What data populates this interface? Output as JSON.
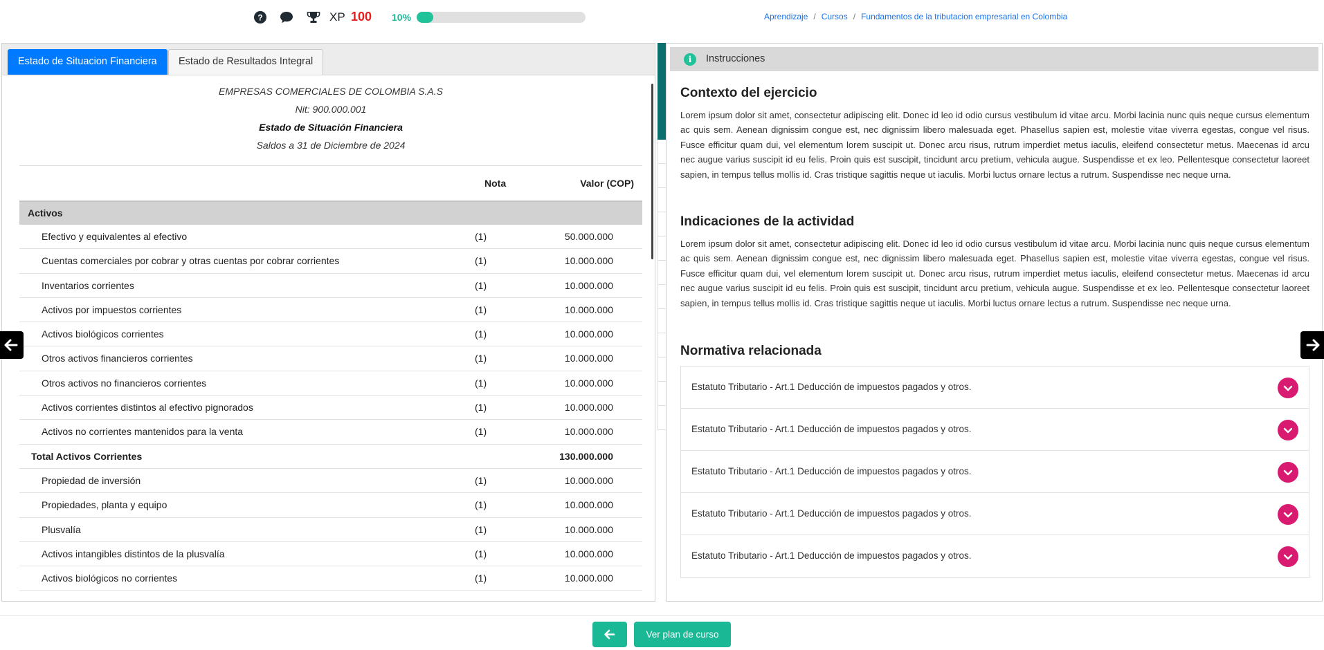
{
  "header": {
    "xp_label": "XP",
    "xp_value": "100",
    "progress_text": "10%",
    "progress_fraction": 0.1,
    "icons": [
      "help-icon",
      "chat-icon",
      "trophy-icon"
    ],
    "breadcrumb": [
      "Aprendizaje",
      "Cursos",
      "Fundamentos de la tributacion empresarial en Colombia"
    ]
  },
  "left": {
    "tabs": [
      "Estado de Situacion Financiera",
      "Estado de Resultados Integral"
    ],
    "company": "EMPRESAS COMERCIALES DE COLOMBIA S.A.S",
    "nit": "Nit: 900.000.001",
    "statement_title": "Estado de Situación Financiera",
    "balance_date": "Saldos a 31 de Diciembre de 2024",
    "columns": {
      "nota": "Nota",
      "valor": "Valor (COP)"
    },
    "section": "Activos",
    "rows_current": [
      {
        "label": "Efectivo y equivalentes al efectivo",
        "nota": "(1)",
        "valor": "50.000.000"
      },
      {
        "label": "Cuentas comerciales por cobrar y otras cuentas por cobrar corrientes",
        "nota": "(1)",
        "valor": "10.000.000"
      },
      {
        "label": "Inventarios corrientes",
        "nota": "(1)",
        "valor": "10.000.000"
      },
      {
        "label": "Activos por impuestos corrientes",
        "nota": "(1)",
        "valor": "10.000.000"
      },
      {
        "label": "Activos biológicos corrientes",
        "nota": "(1)",
        "valor": "10.000.000"
      },
      {
        "label": "Otros activos financieros corrientes",
        "nota": "(1)",
        "valor": "10.000.000"
      },
      {
        "label": "Otros activos no financieros corrientes",
        "nota": "(1)",
        "valor": "10.000.000"
      },
      {
        "label": "Activos corrientes distintos al efectivo pignorados",
        "nota": "(1)",
        "valor": "10.000.000"
      },
      {
        "label": "Activos no corrientes mantenidos para la venta",
        "nota": "(1)",
        "valor": "10.000.000"
      }
    ],
    "total_current": {
      "label": "Total Activos Corrientes",
      "valor": "130.000.000"
    },
    "rows_noncurrent": [
      {
        "label": "Propiedad de inversión",
        "nota": "(1)",
        "valor": "10.000.000"
      },
      {
        "label": "Propiedades, planta y equipo",
        "nota": "(1)",
        "valor": "10.000.000"
      },
      {
        "label": "Plusvalía",
        "nota": "(1)",
        "valor": "10.000.000"
      },
      {
        "label": "Activos intangibles distintos de la plusvalía",
        "nota": "(1)",
        "valor": "10.000.000"
      },
      {
        "label": "Activos biológicos no corrientes",
        "nota": "(1)",
        "valor": "10.000.000"
      }
    ]
  },
  "right": {
    "instructions_title": "Instrucciones",
    "context_title": "Contexto del ejercicio",
    "context_text": "Lorem ipsum dolor sit amet, consectetur adipiscing elit. Donec id leo id odio cursus vestibulum id vitae arcu. Morbi lacinia nunc quis neque cursus elementum ac quis sem. Aenean dignissim congue est, nec dignissim libero malesuada eget. Phasellus sapien est, molestie vitae viverra egestas, congue vel risus. Fusce efficitur quam dui, vel elementum lorem suscipit ut. Donec arcu risus, rutrum imperdiet metus iaculis, eleifend consectetur metus. Maecenas id arcu nec augue varius suscipit id eu felis. Proin quis est suscipit, tincidunt arcu pretium, vehicula augue. Suspendisse et ex leo. Pellentesque consectetur laoreet sapien, in tempus tellus mollis id. Cras tristique sagittis neque ut iaculis. Morbi luctus ornare lectus a rutrum. Suspendisse nec neque urna.",
    "indications_title": "Indicaciones de la actividad",
    "indications_text": "Lorem ipsum dolor sit amet, consectetur adipiscing elit. Donec id leo id odio cursus vestibulum id vitae arcu. Morbi lacinia nunc quis neque cursus elementum ac quis sem. Aenean dignissim congue est, nec dignissim libero malesuada eget. Phasellus sapien est, molestie vitae viverra egestas, congue vel risus. Fusce efficitur quam dui, vel elementum lorem suscipit ut. Donec arcu risus, rutrum imperdiet metus iaculis, eleifend consectetur metus. Maecenas id arcu nec augue varius suscipit id eu felis. Proin quis est suscipit, tincidunt arcu pretium, vehicula augue. Suspendisse et ex leo. Pellentesque consectetur laoreet sapien, in tempus tellus mollis id. Cras tristique sagittis neque ut iaculis. Morbi luctus ornare lectus a rutrum. Suspendisse nec neque urna.",
    "norms_title": "Normativa relacionada",
    "norms": [
      "Estatuto Tributario - Art.1 Deducción de impuestos pagados y otros.",
      "Estatuto Tributario - Art.1 Deducción de impuestos pagados y otros.",
      "Estatuto Tributario - Art.1 Deducción de impuestos pagados y otros.",
      "Estatuto Tributario - Art.1 Deducción de impuestos pagados y otros.",
      "Estatuto Tributario - Art.1 Deducción de impuestos pagados y otros."
    ]
  },
  "footer": {
    "plan_button": "Ver plan de curso"
  },
  "colors": {
    "accent_green": "#1bb896",
    "tab_blue": "#007bff",
    "xp_red": "#e61e1e",
    "norm_pink": "#d81b70"
  }
}
